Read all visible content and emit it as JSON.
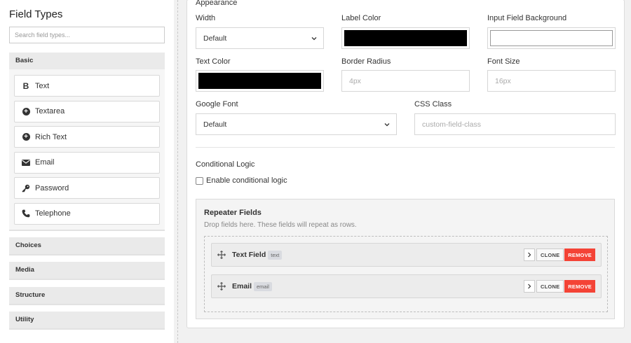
{
  "sidebar": {
    "title": "Field Types",
    "search_placeholder": "Search field types...",
    "groups": [
      {
        "label": "Basic",
        "items": [
          {
            "label": "Text",
            "icon": "bold-icon"
          },
          {
            "label": "Textarea",
            "icon": "plus-circle-icon"
          },
          {
            "label": "Rich Text",
            "icon": "plus-circle-icon"
          },
          {
            "label": "Email",
            "icon": "envelope-icon"
          },
          {
            "label": "Password",
            "icon": "key-icon"
          },
          {
            "label": "Telephone",
            "icon": "phone-icon"
          }
        ]
      },
      {
        "label": "Choices"
      },
      {
        "label": "Media"
      },
      {
        "label": "Structure"
      },
      {
        "label": "Utility"
      }
    ]
  },
  "appearance": {
    "section_label": "Appearance",
    "width_label": "Width",
    "width_value": "Default",
    "label_color_label": "Label Color",
    "label_color_value": "#000000",
    "input_bg_label": "Input Field Background",
    "input_bg_value": "#ffffff",
    "text_color_label": "Text Color",
    "text_color_value": "#000000",
    "border_radius_label": "Border Radius",
    "border_radius_placeholder": "4px",
    "font_size_label": "Font Size",
    "font_size_placeholder": "16px",
    "google_font_label": "Google Font",
    "google_font_value": "Default",
    "css_class_label": "CSS Class",
    "css_class_placeholder": "custom-field-class"
  },
  "conditional": {
    "label": "Conditional Logic",
    "checkbox_label": "Enable conditional logic",
    "checked": false
  },
  "repeater": {
    "title": "Repeater Fields",
    "subtitle": "Drop fields here. These fields will repeat as rows.",
    "items": [
      {
        "name": "Text Field",
        "tag": "text"
      },
      {
        "name": "Email",
        "tag": "email"
      }
    ],
    "clone_label": "CLONE",
    "remove_label": "REMOVE"
  },
  "colors": {
    "remove": "#f44336",
    "panel_bg": "#ffffff",
    "page_bg": "#f1f1f1"
  }
}
